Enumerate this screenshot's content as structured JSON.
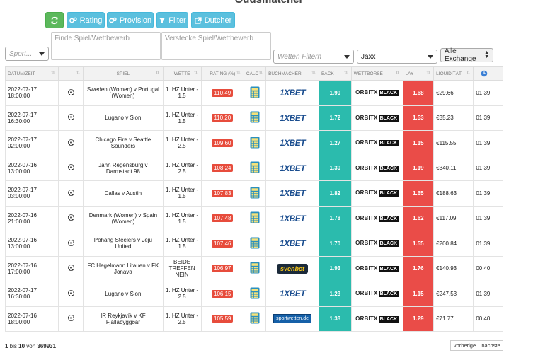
{
  "page": {
    "title": "Oddsmatcher"
  },
  "toolbar": {
    "rating_label": "Rating",
    "provision_label": "Provision",
    "filter_label": "Filter",
    "dutcher_label": "Dutcher"
  },
  "filters": {
    "sport_placeholder": "Sport...",
    "find_placeholder": "Finde Spiel/Wettbewerb",
    "hide_placeholder": "Verstecke Spiel/Wettbewerb",
    "bet_filter_placeholder": "Wetten Filtern",
    "bookmaker_value": "Jaxx",
    "exchange_value": "Alle Exchange"
  },
  "table": {
    "headers": [
      "DATUM/ZEIT",
      "",
      "SPIEL",
      "WETTE",
      "RATING (%)",
      "CALC",
      "BUCHMACHER",
      "BACK",
      "WETTBÖRSE",
      "LAY",
      "LIQUIDITÄT",
      ""
    ],
    "sort_glyph": "⇅",
    "rows": [
      {
        "date": "2022-07-17",
        "time": "18:00:00",
        "match": "Sweden (Women) v Portugal (Women)",
        "bet": "1. HZ Unter - 1.5",
        "rating": "110.49",
        "bookmaker": "1XBET",
        "back": "1.90",
        "exchange": "ORBITX",
        "exchange_tag": "BLACK",
        "lay": "1.68",
        "liquidity": "€29.66",
        "age": "01:39"
      },
      {
        "date": "2022-07-17",
        "time": "16:30:00",
        "match": "Lugano v Sion",
        "bet": "1. HZ Unter - 1.5",
        "rating": "110.20",
        "bookmaker": "1XBET",
        "back": "1.72",
        "exchange": "ORBITX",
        "exchange_tag": "BLACK",
        "lay": "1.53",
        "liquidity": "€35.23",
        "age": "01:39"
      },
      {
        "date": "2022-07-17",
        "time": "02:00:00",
        "match": "Chicago Fire v Seattle Sounders",
        "bet": "1. HZ Unter - 2.5",
        "rating": "109.60",
        "bookmaker": "1XBET",
        "back": "1.27",
        "exchange": "ORBITX",
        "exchange_tag": "BLACK",
        "lay": "1.15",
        "liquidity": "€115.55",
        "age": "01:39"
      },
      {
        "date": "2022-07-16",
        "time": "13:00:00",
        "match": "Jahn Regensburg v Darmstadt 98",
        "bet": "1. HZ Unter - 2.5",
        "rating": "108.24",
        "bookmaker": "1XBET",
        "back": "1.30",
        "exchange": "ORBITX",
        "exchange_tag": "BLACK",
        "lay": "1.19",
        "liquidity": "€340.11",
        "age": "01:39"
      },
      {
        "date": "2022-07-17",
        "time": "03:00:00",
        "match": "Dallas v Austin",
        "bet": "1. HZ Unter - 1.5",
        "rating": "107.83",
        "bookmaker": "1XBET",
        "back": "1.82",
        "exchange": "ORBITX",
        "exchange_tag": "BLACK",
        "lay": "1.65",
        "liquidity": "€188.63",
        "age": "01:39"
      },
      {
        "date": "2022-07-16",
        "time": "21:00:00",
        "match": "Denmark (Women) v Spain (Women)",
        "bet": "1. HZ Unter - 1.5",
        "rating": "107.48",
        "bookmaker": "1XBET",
        "back": "1.78",
        "exchange": "ORBITX",
        "exchange_tag": "BLACK",
        "lay": "1.62",
        "liquidity": "€117.09",
        "age": "01:39"
      },
      {
        "date": "2022-07-16",
        "time": "13:00:00",
        "match": "Pohang Steelers v Jeju United",
        "bet": "1. HZ Unter - 1.5",
        "rating": "107.46",
        "bookmaker": "1XBET",
        "back": "1.70",
        "exchange": "ORBITX",
        "exchange_tag": "BLACK",
        "lay": "1.55",
        "liquidity": "€200.84",
        "age": "01:39"
      },
      {
        "date": "2022-07-16",
        "time": "17:00:00",
        "match": "FC Hegelmann Litauen v FK Jonava",
        "bet": "BEIDE TREFFEN NEIN",
        "rating": "106.97",
        "bookmaker": "svenbet",
        "back": "1.93",
        "exchange": "ORBITX",
        "exchange_tag": "BLACK",
        "lay": "1.76",
        "liquidity": "€140.93",
        "age": "00:40"
      },
      {
        "date": "2022-07-17",
        "time": "16:30:00",
        "match": "Lugano v Sion",
        "bet": "1. HZ Unter - 2.5",
        "rating": "106.15",
        "bookmaker": "1XBET",
        "back": "1.23",
        "exchange": "ORBITX",
        "exchange_tag": "BLACK",
        "lay": "1.15",
        "liquidity": "€247.53",
        "age": "01:39"
      },
      {
        "date": "2022-07-16",
        "time": "18:00:00",
        "match": "IR Reykjavík v KF Fjallabyggðar",
        "bet": "1. HZ Unter - 2.5",
        "rating": "105.59",
        "bookmaker": "sportwetten.de",
        "back": "1.38",
        "exchange": "ORBITX",
        "exchange_tag": "BLACK",
        "lay": "1.29",
        "liquidity": "€71.77",
        "age": "00:40"
      }
    ]
  },
  "footer": {
    "from": "1",
    "mid": " bis ",
    "to": "10",
    "of": " von ",
    "total": "369931",
    "prev_label": "vorherige",
    "next_label": "nächste"
  },
  "colors": {
    "back": "#2bbbad",
    "lay": "#ea4c48",
    "rating": "#e74c3c",
    "button_blue": "#5bc0de",
    "button_green": "#5cb85c"
  }
}
